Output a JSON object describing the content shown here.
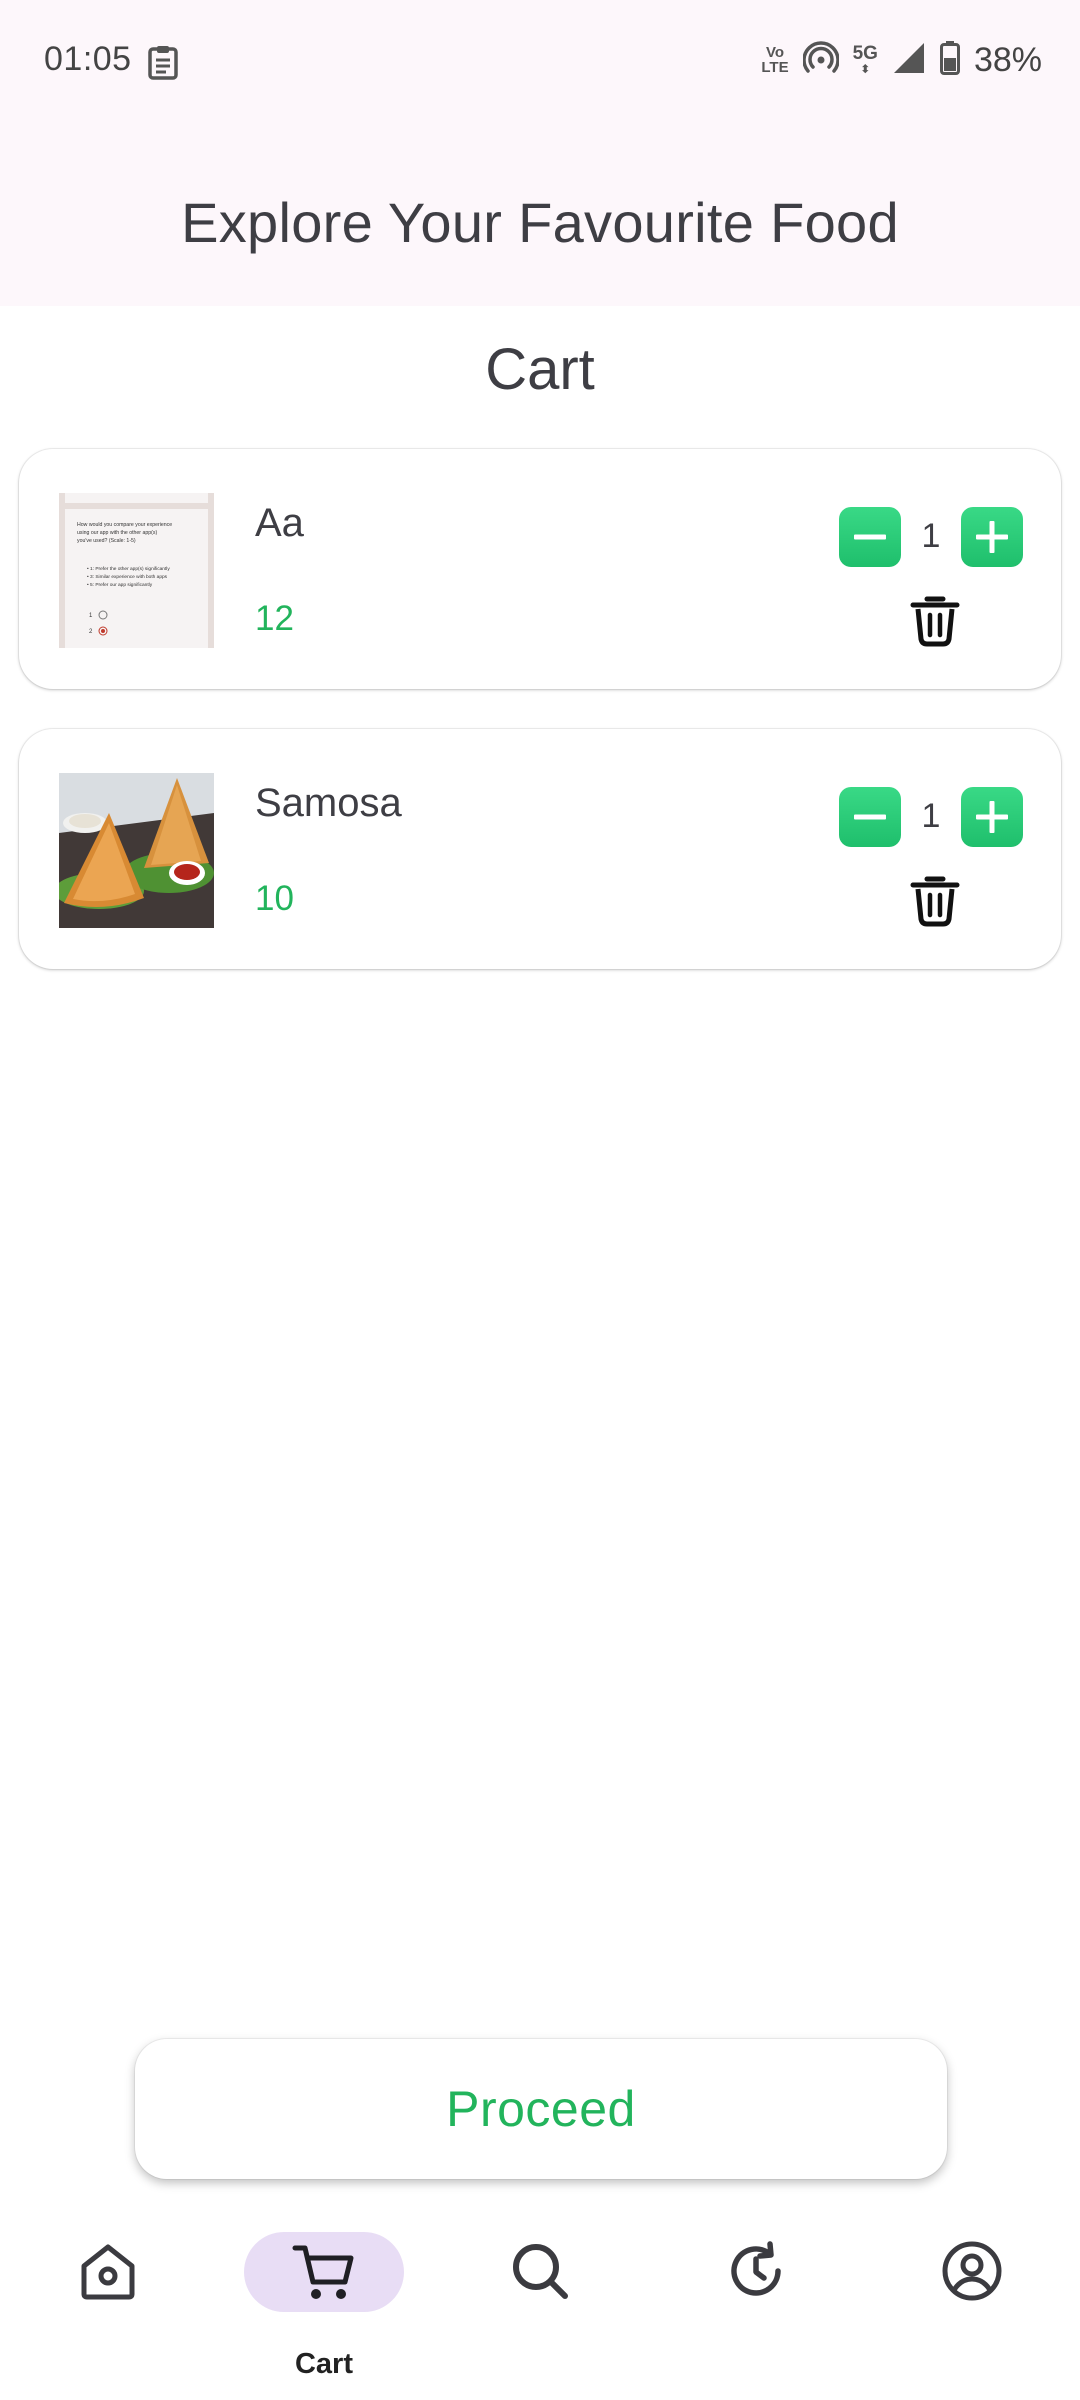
{
  "status_bar": {
    "time": "01:05",
    "volte_top": "Vo",
    "volte_bottom": "LTE",
    "network": "5G",
    "battery": "38%"
  },
  "header": {
    "title": "Explore Your Favourite Food"
  },
  "cart": {
    "heading": "Cart",
    "items": [
      {
        "name": "Aa",
        "price": "12",
        "quantity": "1",
        "thumb_lines": [
          "How would you compare your experience",
          "using our app with the other app(s)",
          "you've used? (Scale: 1-5)",
          "• 1: Prefer the other app(s) significantly",
          "• 3: Similar experience with both apps",
          "• 5: Prefer our app significantly",
          "1",
          "2"
        ]
      },
      {
        "name": "Samosa",
        "price": "10",
        "quantity": "1"
      }
    ]
  },
  "actions": {
    "proceed_label": "Proceed"
  },
  "bottom_nav": {
    "items": [
      {
        "icon": "home-icon",
        "label": ""
      },
      {
        "icon": "cart-icon",
        "label": "Cart"
      },
      {
        "icon": "search-icon",
        "label": ""
      },
      {
        "icon": "history-icon",
        "label": ""
      },
      {
        "icon": "profile-icon",
        "label": ""
      }
    ]
  },
  "colors": {
    "accent_green": "#22b45c",
    "button_green": "#2ccb77",
    "nav_pill": "#e8ddf5",
    "header_bg": "#fdf7fb"
  }
}
